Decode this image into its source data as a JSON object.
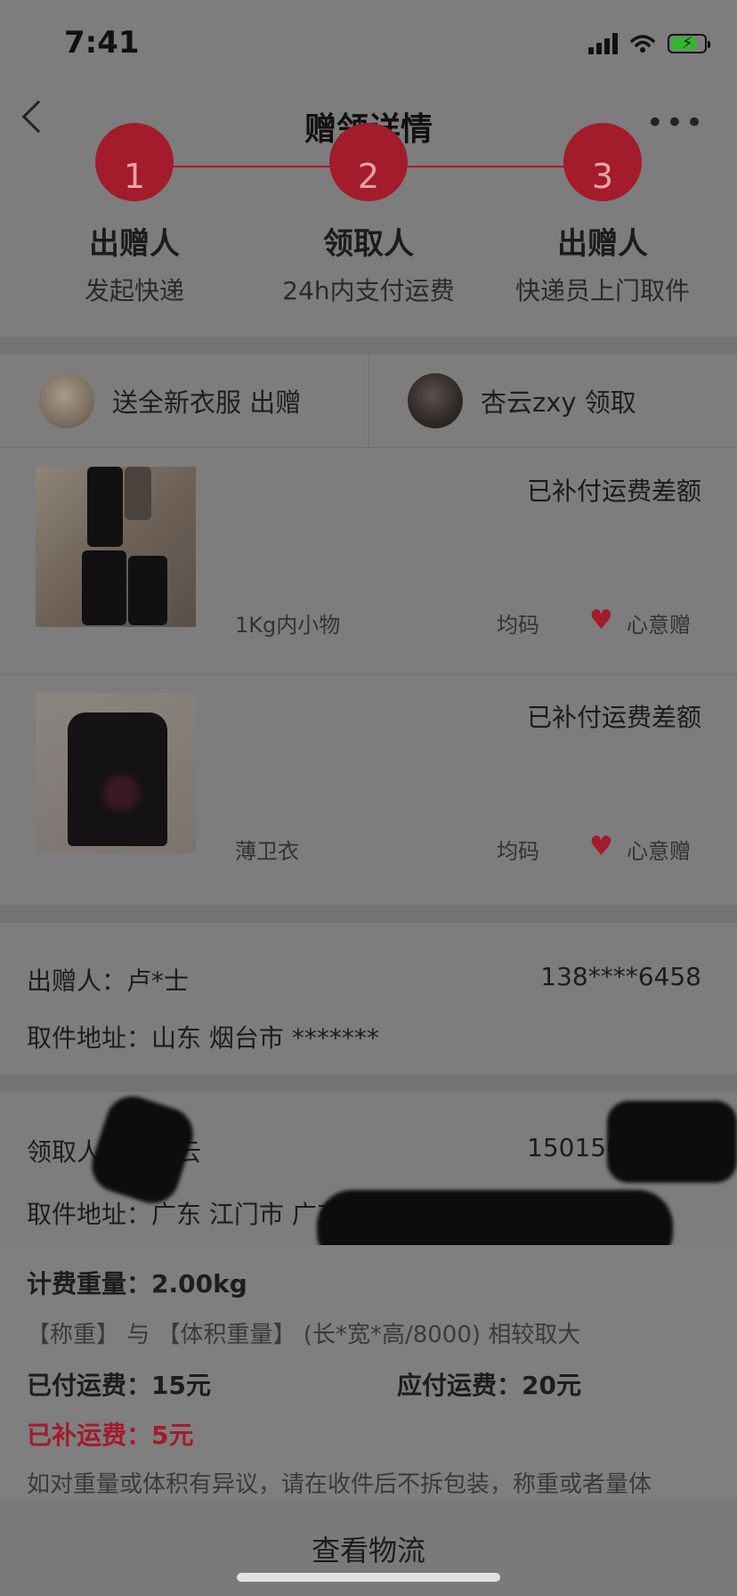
{
  "status_bar": {
    "time": "7:41"
  },
  "nav": {
    "title": "赠领详情"
  },
  "steps": [
    {
      "number": "1",
      "title": "出赠人",
      "subtitle": "发起快递"
    },
    {
      "number": "2",
      "title": "领取人",
      "subtitle": "24h内支付运费"
    },
    {
      "number": "3",
      "title": "出赠人",
      "subtitle": "快递员上门取件"
    }
  ],
  "parties": {
    "giver_label": "送全新衣服 出赠",
    "receiver_label": "杏云zxy 领取"
  },
  "items": [
    {
      "status": "已补付运费差额",
      "name": "1Kg内小物",
      "size": "均码",
      "tag": "心意赠"
    },
    {
      "status": "已补付运费差额",
      "name": "薄卫衣",
      "size": "均码",
      "tag": "心意赠"
    }
  ],
  "giver_info": {
    "name_label": "出赠人：",
    "name": "卢*士",
    "phone": "138****6458",
    "address_label": "取件地址：",
    "address": "山东 烟台市 *******"
  },
  "receiver_info": {
    "name_label": "领取人：",
    "name": "曾杏云",
    "phone": "15015048916",
    "address_label": "取件地址：",
    "address": "广东 江门市 广东江门市台山市台城镇北坑工"
  },
  "shipping": {
    "weight_label": "计费重量：",
    "weight": "2.00kg",
    "rule": "【称重】 与 【体积重量】 (长*宽*高/8000) 相较取大",
    "paid_label": "已付运费：",
    "paid": "15元",
    "due_label": "应付运费：",
    "due": "20元",
    "extra_label": "已补运费：",
    "extra": "5元",
    "note": "如对重量或体积有异议，请在收件后不拆包装，称重或者量体"
  },
  "bottom": {
    "button_label": "查看物流"
  },
  "colors": {
    "accent": "#a21c2c",
    "overlay": "#7d7d7d"
  }
}
